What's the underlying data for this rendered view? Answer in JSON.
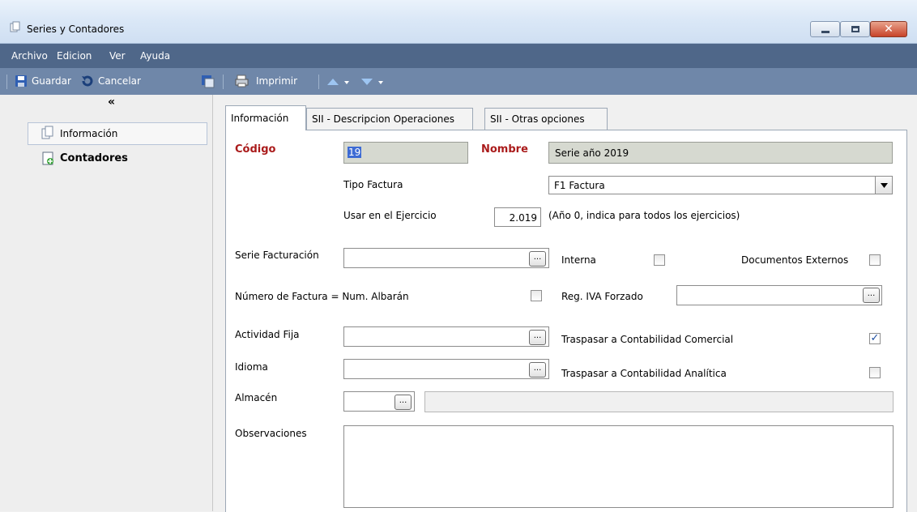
{
  "window": {
    "title": "Series y Contadores",
    "close_glyph": "✕"
  },
  "menu": [
    "Archivo",
    "Edicion",
    "Ver",
    "Ayuda"
  ],
  "toolbar": {
    "save": "Guardar",
    "cancel": "Cancelar",
    "print": "Imprimir"
  },
  "sidebar": {
    "collapse": "«",
    "items": [
      "Información",
      "Contadores"
    ]
  },
  "tabs": [
    "Información",
    "SII - Descripcion Operaciones",
    "SII - Otras opciones"
  ],
  "form": {
    "codigo_label": "Código",
    "codigo_value": "19",
    "nombre_label": "Nombre",
    "nombre_value": "Serie año 2019",
    "tipo_factura_label": "Tipo Factura",
    "tipo_factura_value": "F1 Factura",
    "ejercicio_label": "Usar en el Ejercicio",
    "ejercicio_value": "2.019",
    "ejercicio_hint": "(Año 0, indica para todos los ejercicios)",
    "serie_facturacion_label": "Serie Facturación",
    "interna_label": "Interna",
    "interna_checked": false,
    "doc_externos_label": "Documentos Externos",
    "doc_externos_checked": false,
    "num_factura_label": "Número de Factura = Num. Albarán",
    "num_factura_checked": false,
    "reg_iva_label": "Reg. IVA Forzado",
    "actividad_label": "Actividad Fija",
    "contab_comercial_label": "Traspasar a Contabilidad Comercial",
    "contab_comercial_checked": true,
    "idioma_label": "Idioma",
    "contab_analitica_label": "Traspasar a Contabilidad Analítica",
    "contab_analitica_checked": false,
    "almacen_label": "Almacén",
    "observaciones_label": "Observaciones",
    "ellipsis": "..."
  },
  "colors": {
    "menubar": "#4f6789",
    "toolbar": "#6f87a9",
    "required_label": "#aa1b1b",
    "readonly_field": "#d6d9d0"
  }
}
